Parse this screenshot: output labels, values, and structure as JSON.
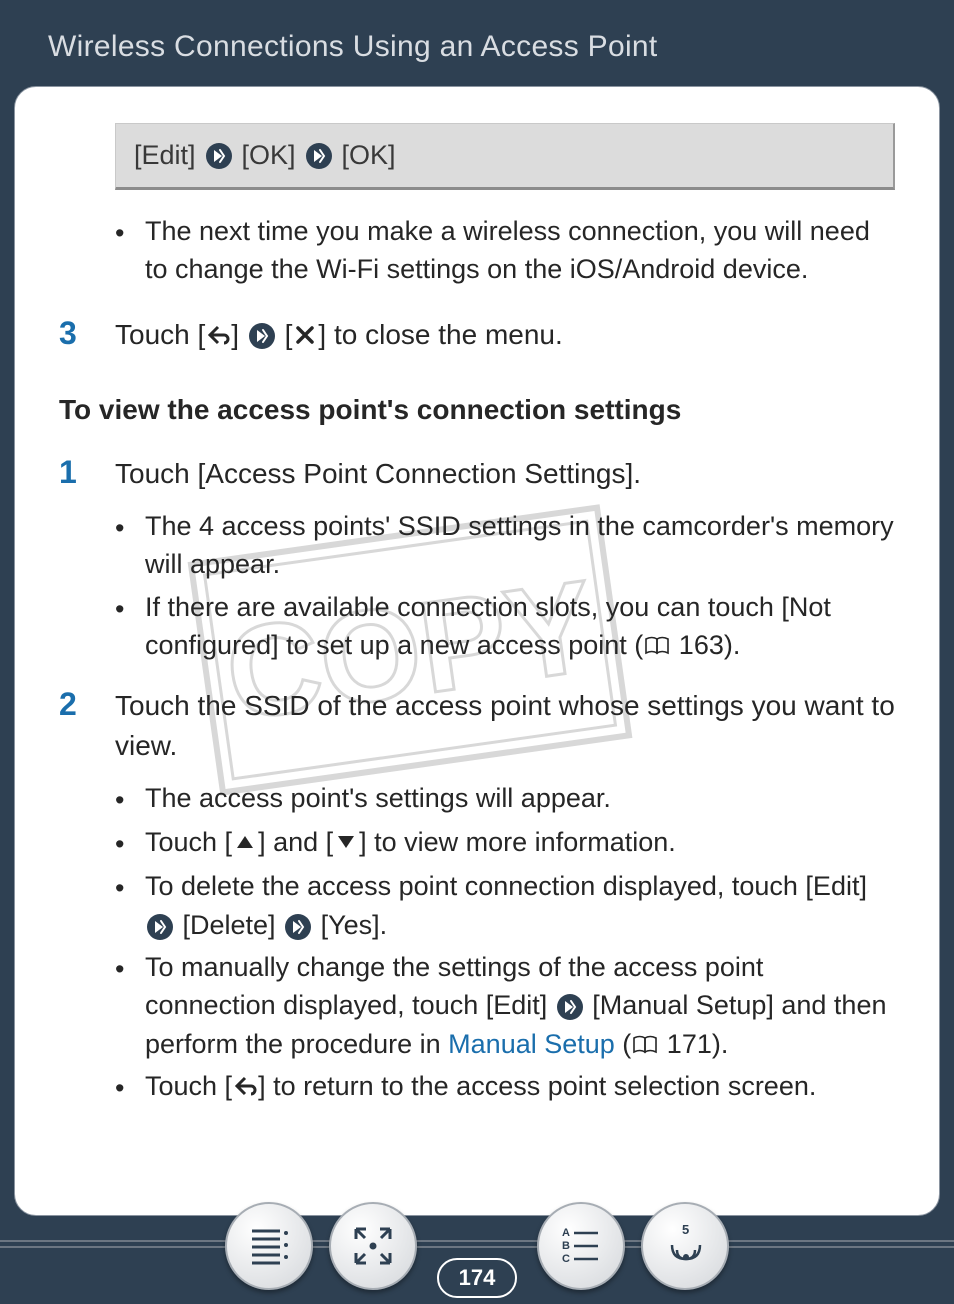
{
  "header": {
    "title": "Wireless Connections Using an Access Point"
  },
  "breadcrumb": {
    "edit": "[Edit]",
    "ok1": "[OK]",
    "ok2": "[OK]"
  },
  "after_box_bullets": [
    "The next time you make a wireless connection, you will need to change the Wi-Fi settings on the iOS/Android device."
  ],
  "step3": {
    "num": "3",
    "pre": "Touch [",
    "mid": "] ",
    "post_open": " [",
    "post_close": "] to close the menu."
  },
  "subheading": "To view the access point's connection settings",
  "step1": {
    "num": "1",
    "text": "Touch [Access Point Connection Settings].",
    "bullets": {
      "b1": "The 4 access points' SSID settings in the camcorder's memory will appear.",
      "b2_pre": "If there are available connection slots, you can touch [Not configured] to set up a new access point (",
      "b2_ref": " 163).",
      "b2_refnum": "163"
    }
  },
  "step2": {
    "num": "2",
    "text": "Touch the SSID of the access point whose settings you want to view.",
    "bullets": {
      "b1": "The access point's settings will appear.",
      "b2_pre": "Touch [",
      "b2_mid": "] and [",
      "b2_post": "] to view more information.",
      "b3_pre": "To delete the access point connection displayed, touch [Edit] ",
      "b3_mid": " [Delete] ",
      "b3_post": " [Yes].",
      "b4_pre": "To manually change the settings of the access point connection displayed, touch [Edit] ",
      "b4_mid": " [Manual Setup] and then perform the procedure in ",
      "b4_link": "Manual Setup",
      "b4_post_open": " (",
      "b4_ref": " 171).",
      "b4_refnum": "171",
      "b5_pre": "Touch [",
      "b5_post": "] to return to the access point selection screen."
    }
  },
  "nav": {
    "page": "174"
  },
  "watermark": "COPY"
}
